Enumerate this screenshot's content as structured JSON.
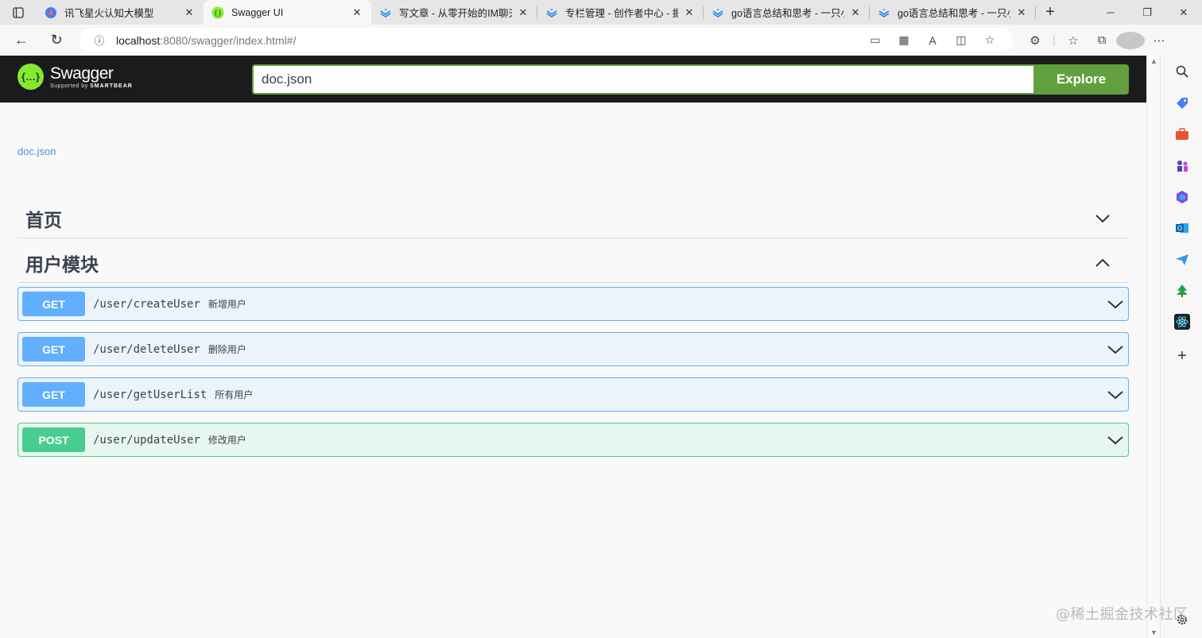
{
  "browser": {
    "tabs": [
      {
        "title": "讯飞星火认知大模型",
        "favicon": "spark-favicon"
      },
      {
        "title": "Swagger UI",
        "favicon": "swagger-favicon",
        "active": true
      },
      {
        "title": "写文章 - 从零开始的IM聊天",
        "favicon": "juejin-favicon"
      },
      {
        "title": "专栏管理 - 创作者中心 - 掘",
        "favicon": "juejin-favicon"
      },
      {
        "title": "go语言总结和思考 - 一只小",
        "favicon": "juejin-favicon"
      },
      {
        "title": "go语言总结和思考 - 一只小",
        "favicon": "juejin-favicon"
      }
    ],
    "url_host": "localhost",
    "url_rest": ":8080/swagger/index.html#/"
  },
  "swagger": {
    "logo_text": "Swagger",
    "logo_sub_prefix": "Supported by",
    "logo_sub_brand": "SMARTBEAR",
    "search_value": "doc.json",
    "explore_label": "Explore",
    "spec_link": "doc.json",
    "tags": [
      {
        "name": "首页",
        "expanded": false
      },
      {
        "name": "用户模块",
        "expanded": true
      }
    ],
    "operations": [
      {
        "method": "GET",
        "path": "/user/createUser",
        "summary": "新增用户"
      },
      {
        "method": "GET",
        "path": "/user/deleteUser",
        "summary": "删除用户"
      },
      {
        "method": "GET",
        "path": "/user/getUserList",
        "summary": "所有用户"
      },
      {
        "method": "POST",
        "path": "/user/updateUser",
        "summary": "修改用户"
      }
    ]
  },
  "colors": {
    "get": "#61affe",
    "post": "#49cc90",
    "explore": "#62a03f",
    "topbar": "#1b1b1b"
  },
  "watermark": "@稀土掘金技术社区"
}
